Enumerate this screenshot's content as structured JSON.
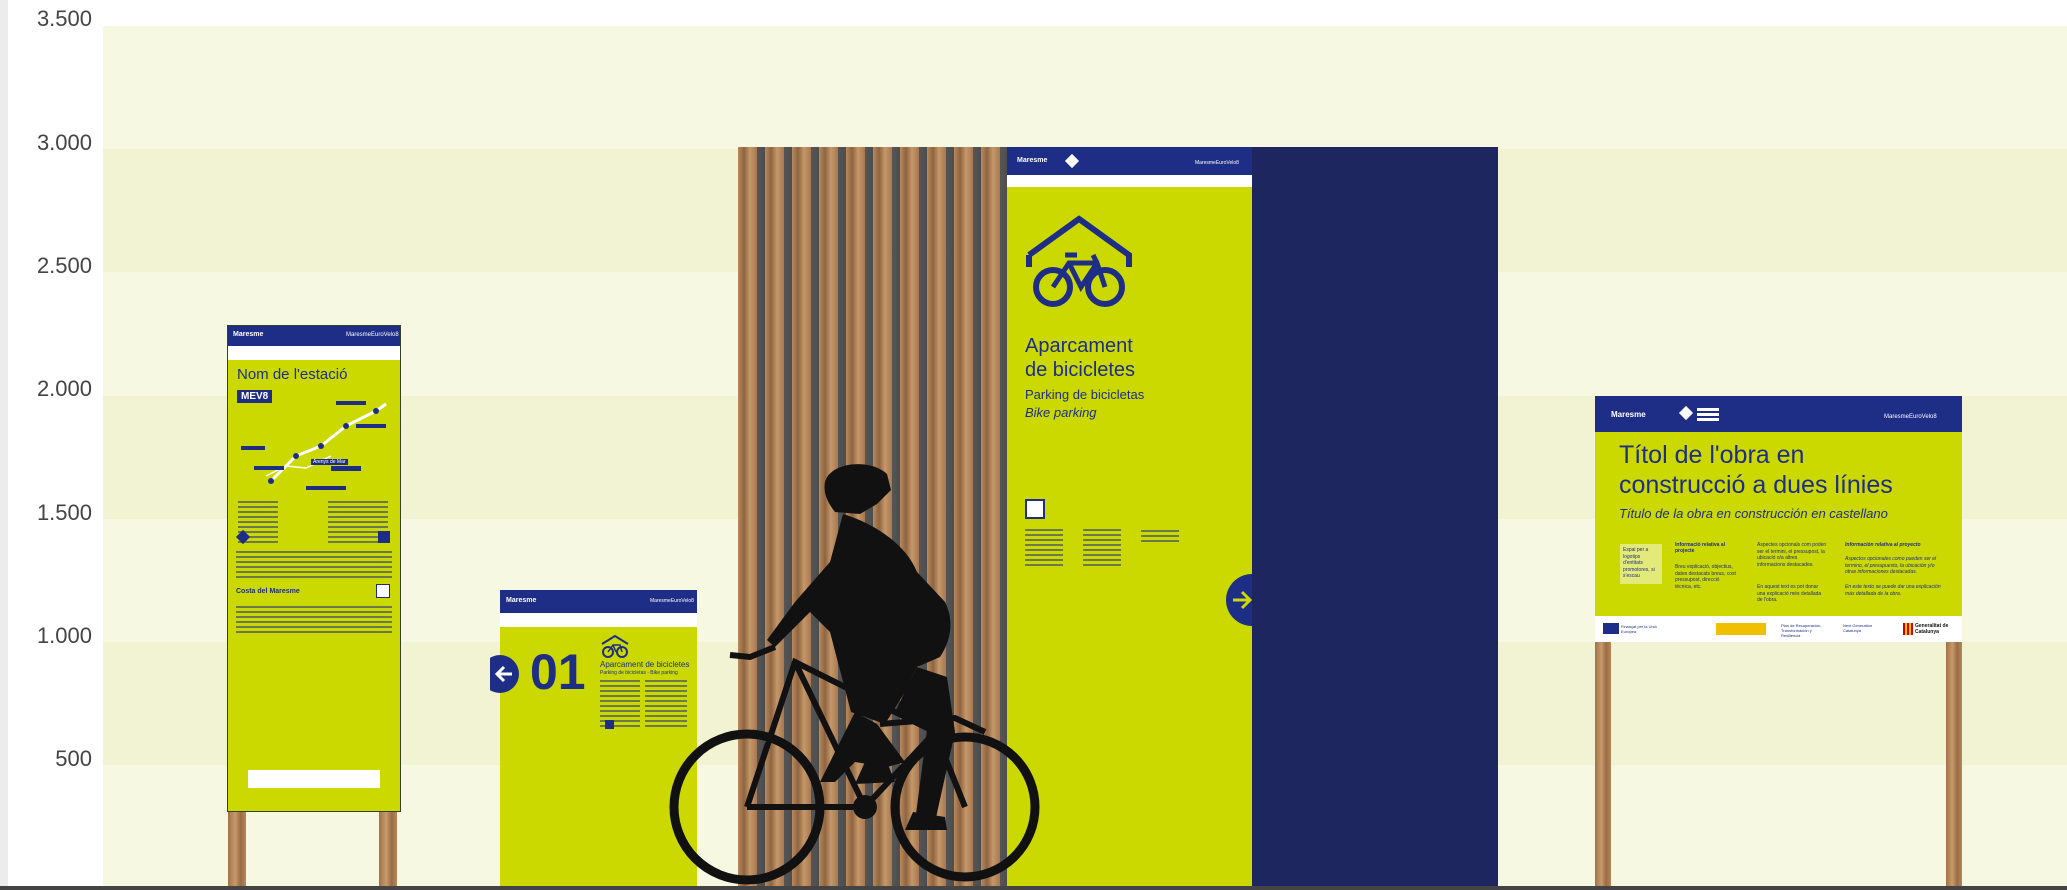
{
  "y_axis": {
    "ticks": [
      "3.500",
      "3.000",
      "2.500",
      "2.000",
      "1.500",
      "1.000",
      "500"
    ]
  },
  "station_panel": {
    "header_brand": "Maresme",
    "header_right": "MaresmeEuroVelo8",
    "title": "Nom de l'estació",
    "badge": "MEV8",
    "map_label": "Arenys de Mar",
    "footer_logo": "Costa del Maresme"
  },
  "small_panel": {
    "header_brand": "Maresme",
    "header_right": "MaresmeEuroVelo8",
    "number": "01",
    "title": "Aparcament de bicicletes",
    "subtitle": "Parking de bicicletas · Bike parking"
  },
  "tall_panel": {
    "header_brand": "Maresme",
    "header_right": "MaresmeEuroVelo8",
    "title_line1": "Aparcament",
    "title_line2": "de bicicletes",
    "subtitle_es": "Parking de bicicletas",
    "subtitle_en": "Bike parking"
  },
  "wide_panel": {
    "header_brand": "Maresme",
    "header_right": "MaresmeEuroVelo8",
    "title_line1": "Títol de l'obra en",
    "title_line2": "construcció a dues línies",
    "subtitle": "Título de la obra en construcción en castellano",
    "box_text": "Espai per a logotips d'entitats promotores, si s'escau",
    "col1_head": "Informació relativa al projecte",
    "col1_text": "Breu explicació, objectius, dates destacats breus, cost pressupost, direcció tècnica, etc.",
    "col2_text": "Aspectes opcionals com poden ser el termini, el pressupost, la ubicació o/a altres informacions destacades.",
    "col2_text2": "En aquest text es pot donar una explicació més detallada de l'obra.",
    "col3_head": "Información relativa al proyecto",
    "col3_text": "Aspectos opcionales como pueden ser el termino, el presupuesto, la ubicación y/o otras informaciones destacadas.",
    "col3_text2": "En este texto se puede dar una explicación más detallada de la obra.",
    "footer_eu": "Finançat per la Unió Europea",
    "footer_gencat": "Generalitat de Catalunya",
    "footer_plan": "Plan de Recuperación, Transformación y Resiliencia",
    "footer_diba": "Next Generation Catalunya"
  },
  "colors": {
    "navy": "#1e2d86",
    "lime": "#cbd900",
    "background_band_light": "#f7f8e2",
    "background_band_dark": "#f1f3d2",
    "slat_gap": "#555555",
    "dark_panel": "#1e2660"
  },
  "icons": [
    "bicycle-icon",
    "arrow-left-icon",
    "arrow-right-icon",
    "qr-code-icon",
    "cyclist-silhouette"
  ]
}
